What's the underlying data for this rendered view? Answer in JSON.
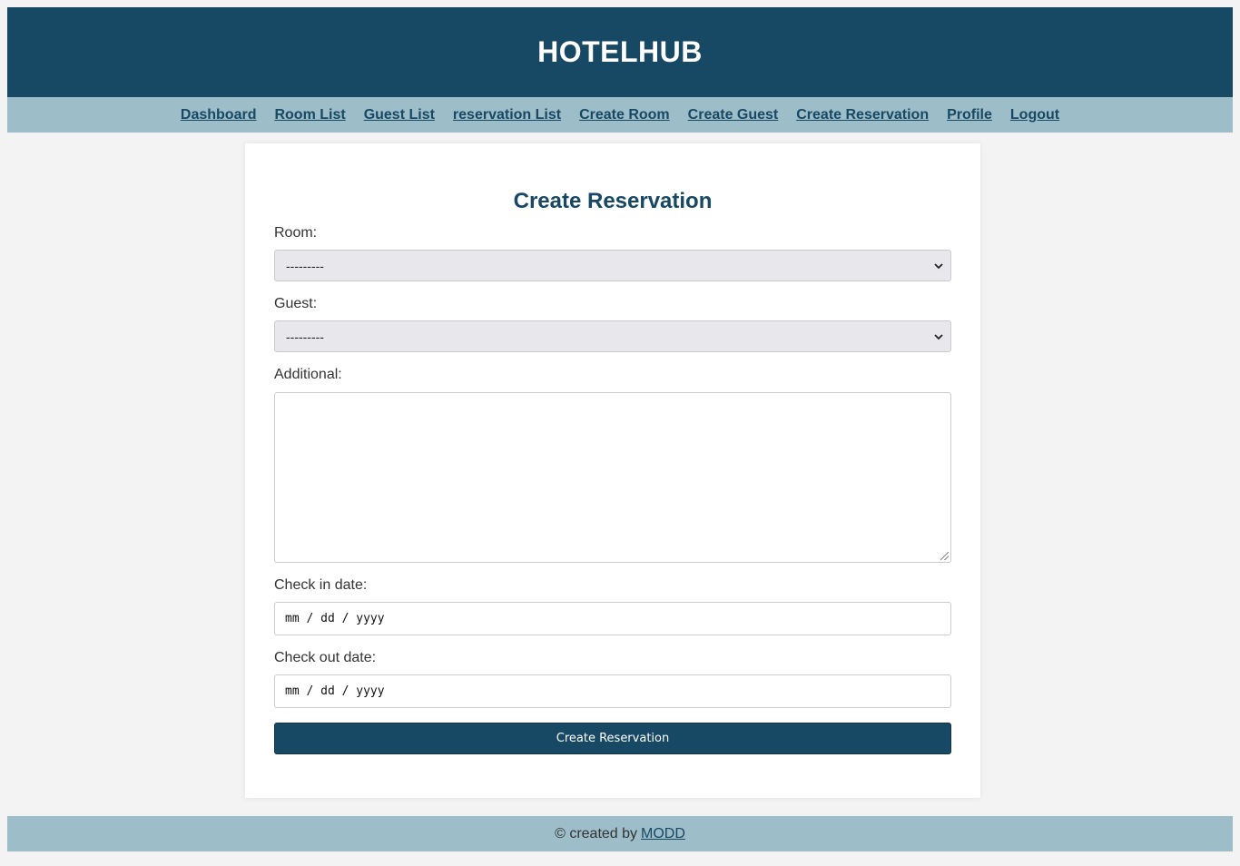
{
  "brand": {
    "title": "HOTELHUB"
  },
  "nav": {
    "items": [
      {
        "label": "Dashboard"
      },
      {
        "label": "Room List"
      },
      {
        "label": "Guest List"
      },
      {
        "label": "reservation List"
      },
      {
        "label": "Create Room"
      },
      {
        "label": "Create Guest"
      },
      {
        "label": "Create Reservation"
      },
      {
        "label": "Profile"
      },
      {
        "label": "Logout"
      }
    ]
  },
  "form": {
    "heading": "Create Reservation",
    "room": {
      "label": "Room:",
      "value": "---------"
    },
    "guest": {
      "label": "Guest:",
      "value": "---------"
    },
    "additional": {
      "label": "Additional:",
      "value": ""
    },
    "check_in": {
      "label": "Check in date:",
      "placeholder": "mm / dd / yyyy"
    },
    "check_out": {
      "label": "Check out date:",
      "placeholder": "mm / dd / yyyy"
    },
    "submit_label": "Create Reservation"
  },
  "footer": {
    "prefix": "© created by",
    "link_label": "MODD"
  },
  "colors": {
    "primary": "#174864",
    "secondary": "#9dbdc8",
    "background": "#f3f3f3"
  }
}
